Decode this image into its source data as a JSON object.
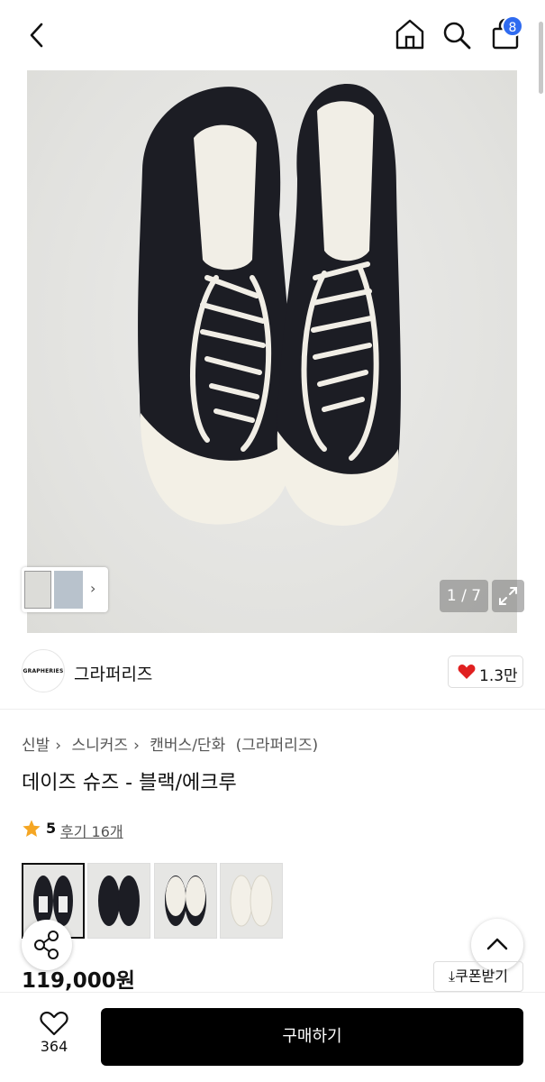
{
  "header": {
    "icons": [
      "chevron-left-icon",
      "home-icon",
      "search-icon",
      "shopping-bag-icon"
    ],
    "cart_badge": "8",
    "badge_color": "#2f6bf0"
  },
  "gallery": {
    "counter": "1 / 7",
    "expand_icon": "expand-icon"
  },
  "brand": {
    "logo_text": "GRAPHERIES",
    "name": "그라퍼리즈",
    "like_count": "1.3만",
    "heart_color": "#e02020"
  },
  "product": {
    "breadcrumb": [
      "신발",
      "스니커즈",
      "캔버스/단화",
      "(그라퍼리즈)"
    ],
    "title": "데이즈 슈즈 - 블랙/에크루",
    "rating": "5",
    "reviews": "후기 16개",
    "price": "119,000원",
    "coupon_label": "쿠폰받기",
    "star_color": "#f5a623"
  },
  "bottom": {
    "wish_count": "364",
    "buy_label": "구매하기"
  }
}
